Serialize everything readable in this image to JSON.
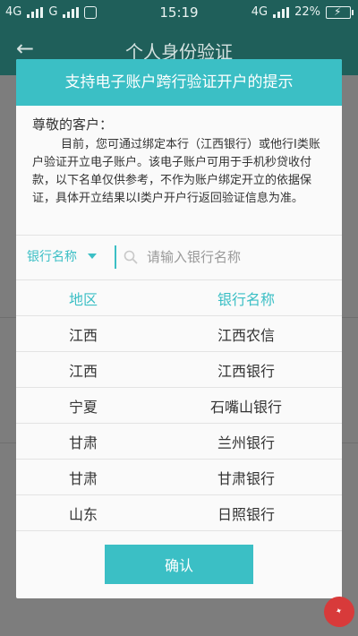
{
  "status_bar": {
    "net1": "4G",
    "net2": "G",
    "time": "15:19",
    "net3": "4G",
    "battery": "22%"
  },
  "app_header": {
    "title": "个人身份验证"
  },
  "dialog": {
    "title": "支持电子账户跨行验证开户的提示",
    "greeting": "尊敬的客户：",
    "notice": "目前，您可通过绑定本行（江西银行）或他行I类账户验证开立电子账户。该电子账户可用于手机秒贷收付款，以下名单仅供参考，不作为账户绑定开立的依据保证，具体开立结果以I类户开户行返回验证信息为准。",
    "filter_label": "银行名称",
    "search_placeholder": "请输入银行名称",
    "table": {
      "headers": [
        "地区",
        "银行名称"
      ],
      "rows": [
        [
          "江西",
          "江西农信"
        ],
        [
          "江西",
          "江西银行"
        ],
        [
          "宁夏",
          "石嘴山银行"
        ],
        [
          "甘肃",
          "兰州银行"
        ],
        [
          "甘肃",
          "甘肃银行"
        ],
        [
          "山东",
          "日照银行"
        ]
      ]
    },
    "confirm_label": "确认"
  },
  "colors": {
    "accent": "#3bbfc5",
    "header_dark": "#1f5f5a"
  }
}
